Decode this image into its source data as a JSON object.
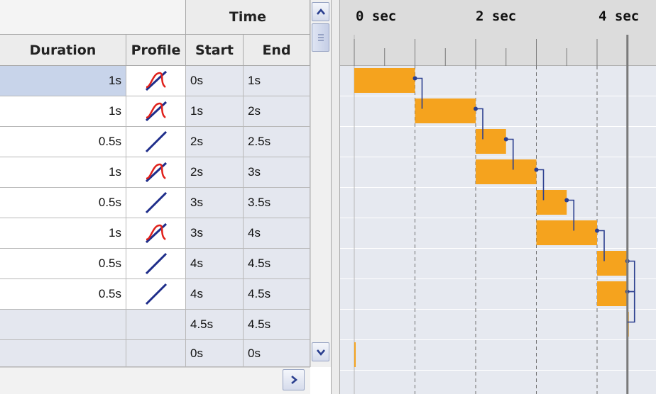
{
  "header": {
    "time_group": "Time",
    "columns": {
      "duration": "Duration",
      "profile": "Profile",
      "start": "Start",
      "end": "End"
    }
  },
  "rows": [
    {
      "duration": "1s",
      "profile": "ease",
      "start": "0s",
      "end": "1s"
    },
    {
      "duration": "1s",
      "profile": "ease",
      "start": "1s",
      "end": "2s"
    },
    {
      "duration": "0.5s",
      "profile": "linear",
      "start": "2s",
      "end": "2.5s"
    },
    {
      "duration": "1s",
      "profile": "ease",
      "start": "2s",
      "end": "3s"
    },
    {
      "duration": "0.5s",
      "profile": "linear",
      "start": "3s",
      "end": "3.5s"
    },
    {
      "duration": "1s",
      "profile": "ease",
      "start": "3s",
      "end": "4s"
    },
    {
      "duration": "0.5s",
      "profile": "linear",
      "start": "4s",
      "end": "4.5s"
    },
    {
      "duration": "0.5s",
      "profile": "linear",
      "start": "4s",
      "end": "4.5s"
    },
    {
      "duration": "",
      "profile": "",
      "start": "4.5s",
      "end": "4.5s"
    },
    {
      "duration": "",
      "profile": "",
      "start": "0s",
      "end": "0s"
    }
  ],
  "timeline": {
    "labels": [
      "0 sec",
      "2 sec",
      "4 sec"
    ],
    "bars": [
      {
        "start": 0,
        "end": 1
      },
      {
        "start": 1,
        "end": 2
      },
      {
        "start": 2,
        "end": 2.5
      },
      {
        "start": 2,
        "end": 3
      },
      {
        "start": 3,
        "end": 3.5
      },
      {
        "start": 3,
        "end": 4
      },
      {
        "start": 4,
        "end": 4.5
      },
      {
        "start": 4,
        "end": 4.5
      },
      {
        "start": 4.5,
        "end": 4.5
      },
      {
        "start": 0,
        "end": 0
      }
    ],
    "current_time": 4.5
  },
  "colors": {
    "bar": "#f5a31e",
    "connector": "#2b3f8f",
    "selected_row": "#c8d4ea"
  },
  "icons": {
    "scroll_up": "arrow-up-icon",
    "scroll_down": "arrow-down-icon",
    "scroll_right": "arrow-right-icon",
    "thumb": "scroll-thumb-grip-icon"
  }
}
